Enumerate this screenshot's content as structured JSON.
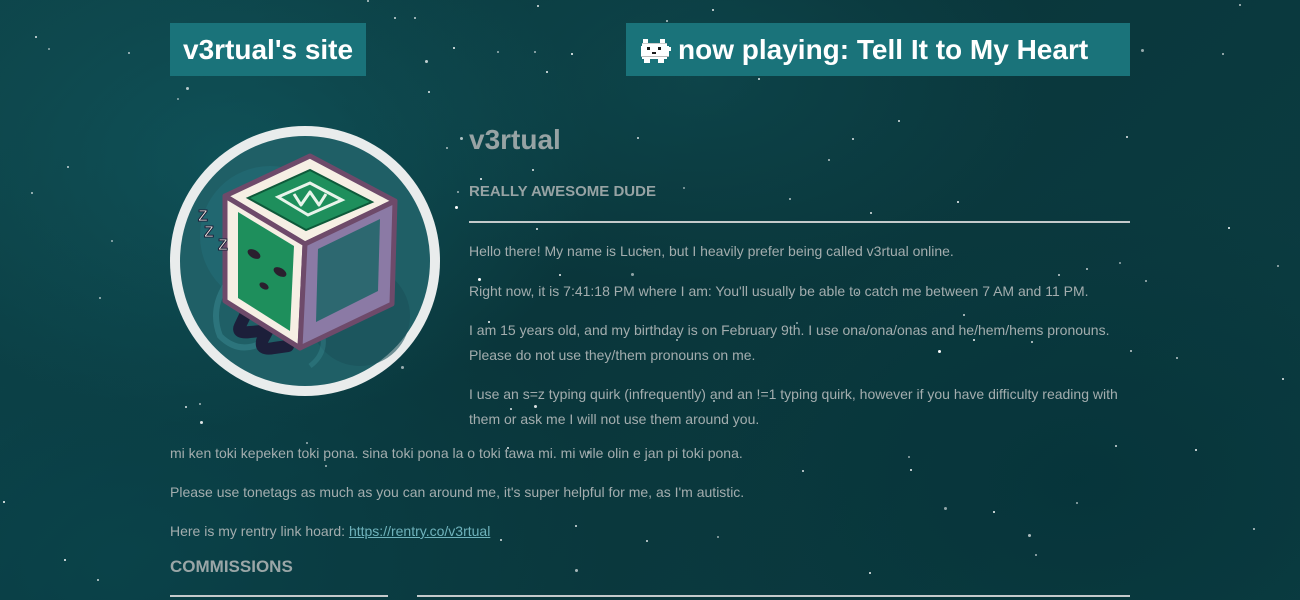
{
  "header": {
    "site_title": "v3rtual's site",
    "now_playing": "now playing: Tell It to My Heart",
    "now_playing_icon": "pixel-cat-icon"
  },
  "profile": {
    "avatar_icon": "sleepy-green-cube-avatar",
    "name": "v3rtual",
    "tagline": "REALLY AWESOME DUDE",
    "paragraphs": [
      "Hello there! My name is Lucien, but I heavily prefer being called v3rtual online.",
      "Right now, it is 7:41:18 PM where I am: You'll usually be able to catch me between 7 AM and 11 PM.",
      "I am 15 years old, and my birthday is on February 9th. I use ona/ona/onas and he/hem/hems pronouns. Please do not use they/them pronouns on me.",
      "I use an s=z typing quirk (infrequently) and an !=1 typing quirk, however if you have difficulty reading with them or ask me I will not use them around you."
    ]
  },
  "about": {
    "toki_pona": "mi ken toki kepeken toki pona. sina toki pona la o toki tawa mi. mi wile olin e jan pi toki pona.",
    "tonetags": "Please use tonetags as much as you can around me, it's super helpful for me, as I'm autistic.",
    "rentry_prefix": "Here is my rentry link hoard: ",
    "rentry_link": "https://rentry.co/v3rtual"
  },
  "commissions": {
    "heading": "COMMISSIONS"
  },
  "colors": {
    "background": "#0c3a3f",
    "title_box": "#1a737a",
    "text": "#a3adae",
    "link": "#6fb3bc"
  }
}
